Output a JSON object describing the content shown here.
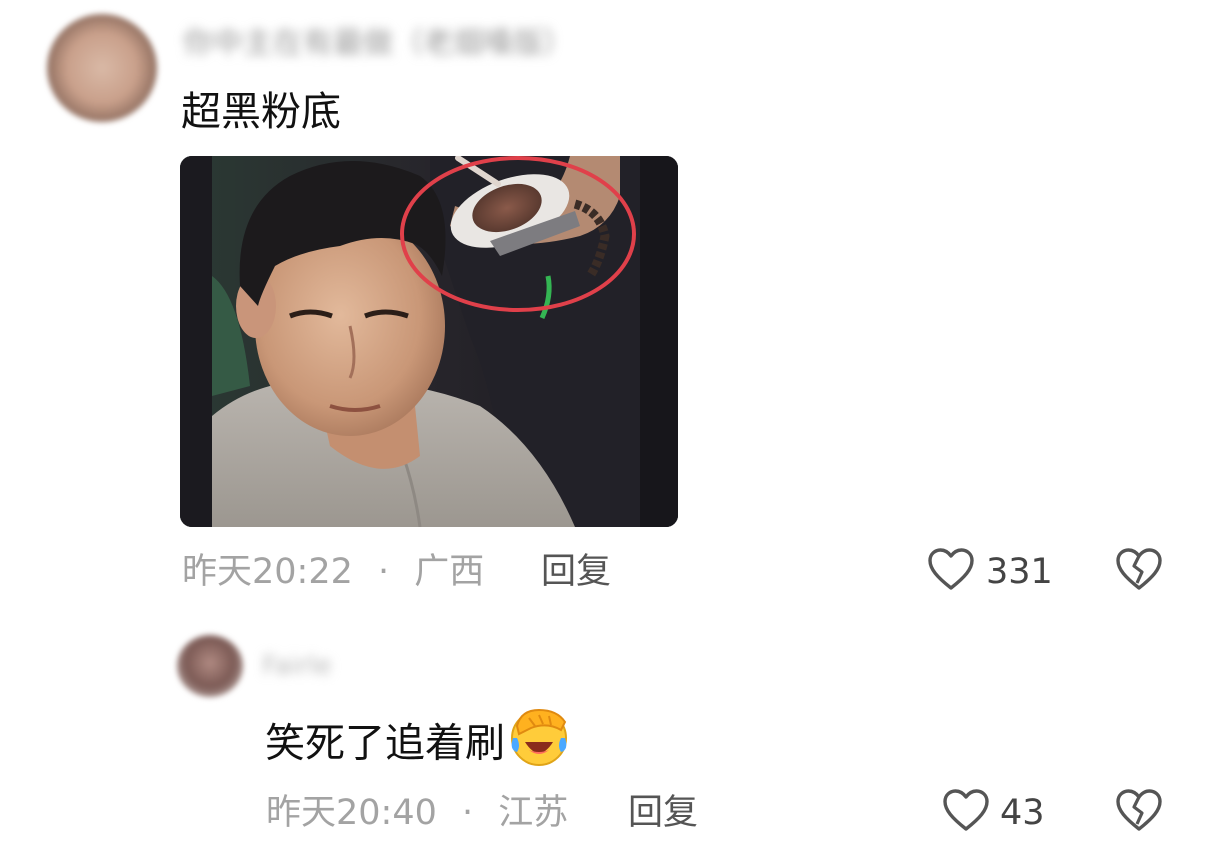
{
  "comments": [
    {
      "username": "你中主在有最做（老烟嗓版）",
      "text": "超黑粉底",
      "time": "昨天20:22",
      "separator": "·",
      "location": "广西",
      "reply_label": "回复",
      "likes": "331",
      "has_image": true
    },
    {
      "username": "Fairle",
      "text": "笑死了追着刷",
      "emoji": "facepalm-laughing-emoji",
      "time": "昨天20:40",
      "separator": "·",
      "location": "江苏",
      "reply_label": "回复",
      "likes": "43",
      "has_image": false
    }
  ],
  "icons": {
    "like": "heart-outline-icon",
    "dislike": "broken-heart-icon"
  },
  "colors": {
    "meta_text": "#a3a3a3",
    "reply_text": "#555555",
    "icon_stroke": "#555555",
    "highlight_circle": "#e0404a"
  }
}
